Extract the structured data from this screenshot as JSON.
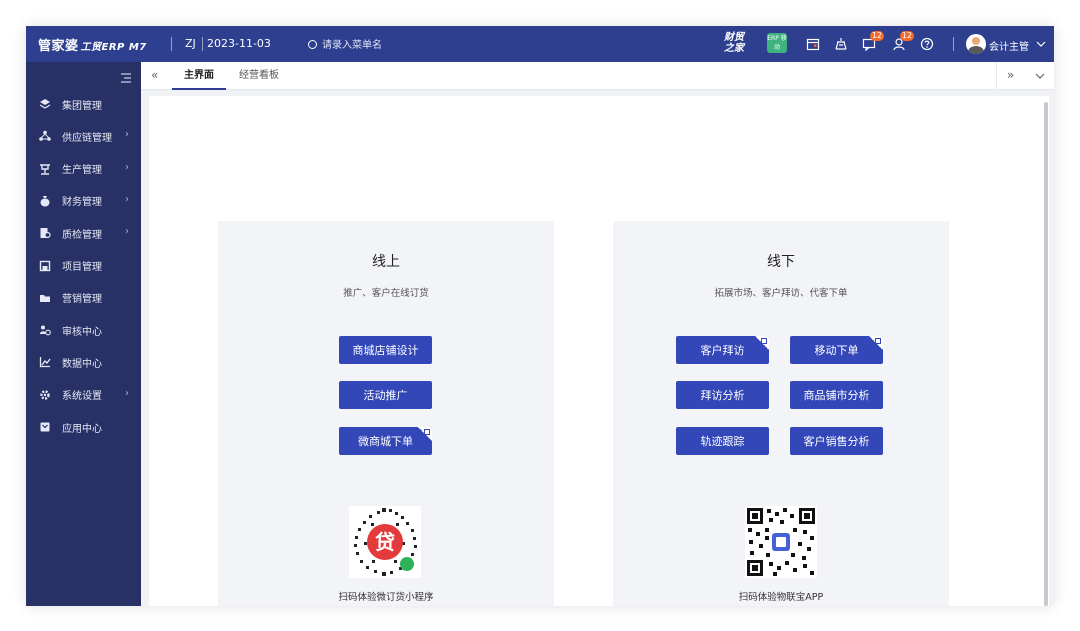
{
  "topbar": {
    "logo_main": "管家婆",
    "logo_sub": "工贸ERP M7",
    "company": "ZJ",
    "date": "2023-11-03",
    "search_placeholder": "请录入菜单名",
    "brand_mark": "财贸之家",
    "app_badge": "ERP 移动",
    "message_badge": "12",
    "notice_badge": "12",
    "user_name": "会计主管"
  },
  "sidebar": {
    "items": [
      {
        "label": "集团管理",
        "icon": "layers-icon",
        "has_children": false
      },
      {
        "label": "供应链管理",
        "icon": "supply-chain-icon",
        "has_children": true
      },
      {
        "label": "生产管理",
        "icon": "production-icon",
        "has_children": true
      },
      {
        "label": "财务管理",
        "icon": "money-bag-icon",
        "has_children": true
      },
      {
        "label": "质检管理",
        "icon": "inspection-icon",
        "has_children": true
      },
      {
        "label": "项目管理",
        "icon": "project-icon",
        "has_children": false
      },
      {
        "label": "营销管理",
        "icon": "folder-icon",
        "has_children": false
      },
      {
        "label": "审核中心",
        "icon": "audit-icon",
        "has_children": false
      },
      {
        "label": "数据中心",
        "icon": "chart-icon",
        "has_children": false
      },
      {
        "label": "系统设置",
        "icon": "settings-icon",
        "has_children": true
      },
      {
        "label": "应用中心",
        "icon": "app-icon",
        "has_children": false
      }
    ]
  },
  "tabs": [
    {
      "label": "主界面",
      "active": true
    },
    {
      "label": "经营看板",
      "active": false
    }
  ],
  "online": {
    "title": "线上",
    "subtitle": "推广、客户在线订货",
    "buttons": [
      {
        "label": "商城店铺设计",
        "qr_corner": false
      },
      {
        "label": "活动推广",
        "qr_corner": false
      },
      {
        "label": "微商城下单",
        "qr_corner": true
      }
    ],
    "qr_caption": "扫码体验微订货小程序"
  },
  "offline": {
    "title": "线下",
    "subtitle": "拓展市场、客户拜访、代客下单",
    "buttons": [
      {
        "label": "客户拜访",
        "qr_corner": true
      },
      {
        "label": "移动下单",
        "qr_corner": true
      },
      {
        "label": "拜访分析",
        "qr_corner": false
      },
      {
        "label": "商品铺市分析",
        "qr_corner": false
      },
      {
        "label": "轨迹跟踪",
        "qr_corner": false
      },
      {
        "label": "客户销售分析",
        "qr_corner": false
      }
    ],
    "qr_caption": "扫码体验物联宝APP"
  },
  "colors": {
    "topbar": "#2e3f8f",
    "sidebar": "#283166",
    "button": "#3347b9",
    "panel": "#f3f4f8"
  }
}
